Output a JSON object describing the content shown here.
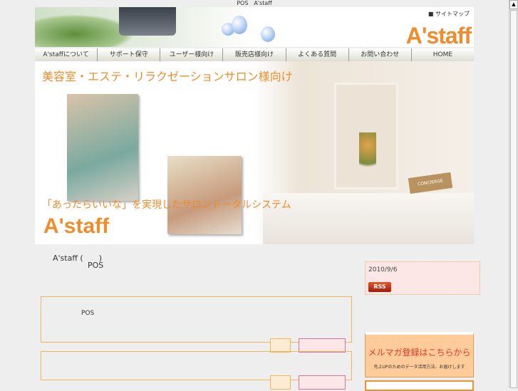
{
  "window_title": "POS　A'staff",
  "header": {
    "sitemap": "サイトマップ",
    "logo": "A'staff"
  },
  "nav": [
    "A'staffについて",
    "サポート保守",
    "ユーザー様向け",
    "販売店様向け",
    "よくある質問",
    "お問い合わせ",
    "HOME"
  ],
  "hero": {
    "headline": "美容室・エステ・リラクゼーションサロン様向け",
    "tagline": "「あったらいいな」を実現したサロントータルシステム",
    "logo": "A'staff",
    "sign": "CONCIERGE"
  },
  "intro": {
    "line1": "A'staff (　　)",
    "line2": "POS"
  },
  "boxes": [
    {
      "text": "POS"
    },
    {
      "text": ""
    }
  ],
  "sidebar": {
    "date": "2010/9/6",
    "rss": "RSS",
    "mailmag_title": "メルマガ登録はこちらから",
    "mailmag_sub": "売上UPのためのデータ活用方法、お届けします"
  }
}
